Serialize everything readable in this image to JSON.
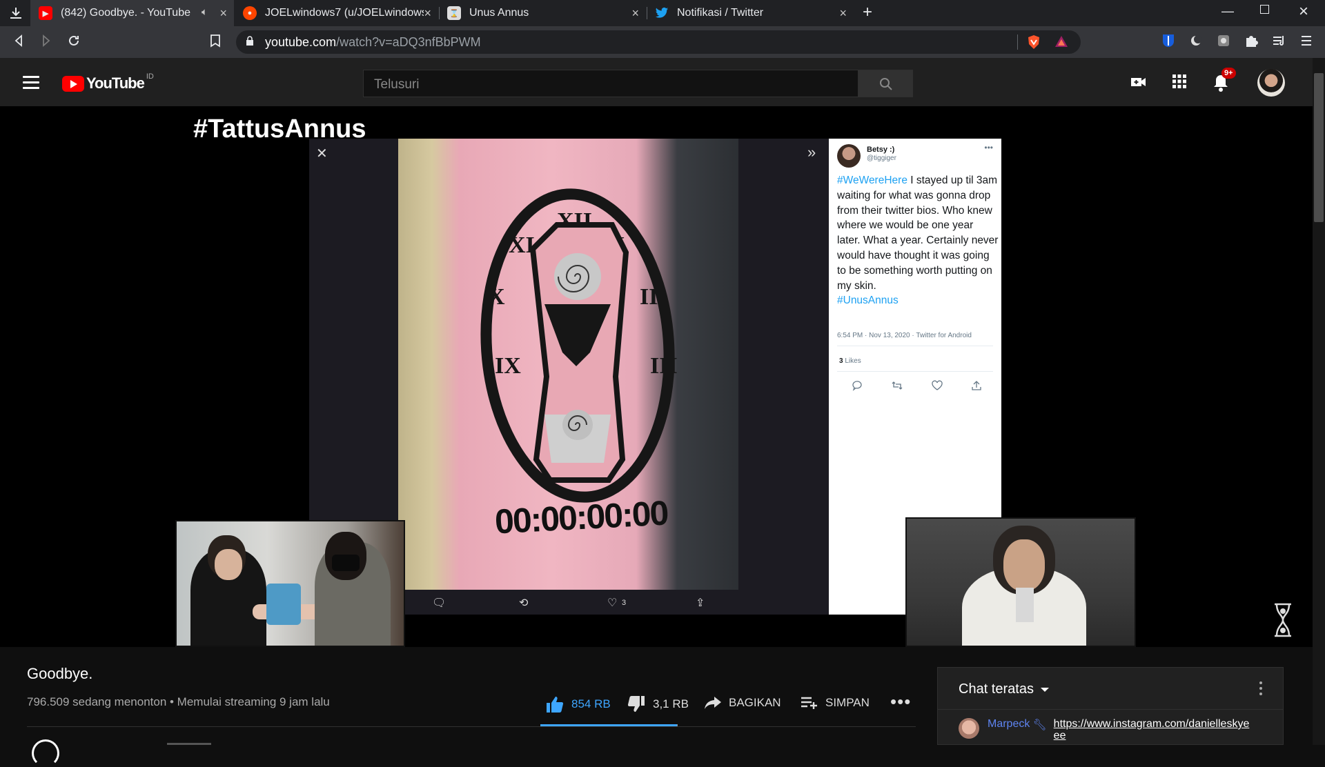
{
  "browser": {
    "tabs": [
      {
        "title": "(842) Goodbye. - YouTube",
        "favicon": "youtube-icon",
        "muted": true
      },
      {
        "title": "JOELwindows7 (u/JOELwindows7)",
        "favicon": "reddit-icon"
      },
      {
        "title": "Unus Annus",
        "favicon": "unus-annus-icon"
      },
      {
        "title": "Notifikasi / Twitter",
        "favicon": "twitter-icon"
      }
    ],
    "url_host": "youtube.com",
    "url_path": "/watch?v=aDQ3nfBbPWM"
  },
  "youtube": {
    "logo_text": "YouTube",
    "country_code": "ID",
    "search_placeholder": "Telusuri",
    "notification_badge": "9+"
  },
  "video_overlay": {
    "heading": "#TattusAnnus",
    "tattoo_counter": "00:00:00:00",
    "tweet_like_count": "3",
    "tweet": {
      "name": "Betsy :)",
      "handle": "@tiggiger",
      "tag1": "#WeWereHere",
      "text": " I stayed up til 3am waiting for what was gonna drop from their twitter bios. Who knew where we would be one year later.  What a year. Certainly never would have thought it was going to be something worth putting on my skin.",
      "tag2": "#UnusAnnus",
      "meta": "6:54 PM · Nov 13, 2020 · Twitter for Android",
      "likes_count": "3",
      "likes_label": "Likes"
    }
  },
  "video_info": {
    "title": "Goodbye.",
    "meta": "796.509 sedang menonton • Memulai streaming 9 jam lalu",
    "like_count": "854 RB",
    "dislike_count": "3,1 RB",
    "share_label": "BAGIKAN",
    "save_label": "SIMPAN",
    "like_ratio": 0.996
  },
  "chat": {
    "header": "Chat teratas",
    "message": {
      "author": "Marpeck",
      "text": "https://www.instagram.com/danielleskyeee"
    }
  },
  "colors": {
    "accent": "#3ea6ff",
    "youtube_red": "#ff0000",
    "twitter_blue": "#1da1f2"
  }
}
